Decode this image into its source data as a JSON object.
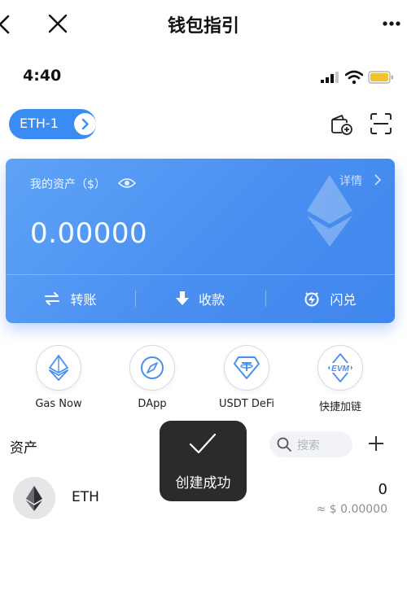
{
  "navbar": {
    "title": "钱包指引",
    "back_icon": "chevron-left-icon",
    "close_icon": "close-icon",
    "more_icon": "more-dots-icon"
  },
  "status_bar": {
    "time": "4:40"
  },
  "wallet": {
    "name": "ETH-1",
    "accent_color": "#3b8cf2"
  },
  "asset_card": {
    "label": "我的资产（$）",
    "detail_link": "详情",
    "balance": "0.00000",
    "actions": [
      {
        "label": "转账",
        "icon": "transfer-arrows-icon"
      },
      {
        "label": "收款",
        "icon": "download-arrow-icon"
      },
      {
        "label": "闪兑",
        "icon": "flash-swap-icon"
      }
    ]
  },
  "quick_apps": [
    {
      "label": "Gas Now",
      "icon": "gas-eth-icon"
    },
    {
      "label": "DApp",
      "icon": "compass-icon"
    },
    {
      "label": "USDT DeFi",
      "icon": "usdt-diamond-icon"
    },
    {
      "label": "快捷加链",
      "icon": "evm-icon",
      "icon_text": "EVM"
    }
  ],
  "assets": {
    "title": "资产",
    "search_placeholder": "搜索",
    "tokens": [
      {
        "symbol": "ETH",
        "amount": "0",
        "fiat_value": "≈ $ 0.00000",
        "icon": "eth-icon"
      }
    ]
  },
  "toast": {
    "message": "创建成功",
    "icon": "checkmark-icon"
  }
}
